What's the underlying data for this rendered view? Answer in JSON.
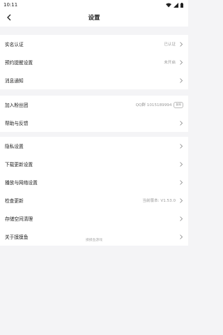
{
  "status_bar": {
    "time": "10:11"
  },
  "header": {
    "title": "设置"
  },
  "group1": [
    {
      "label": "实名认证",
      "value": "已认证"
    },
    {
      "label": "预约提醒设置",
      "value": "未开启"
    },
    {
      "label": "消息通知",
      "value": ""
    }
  ],
  "group2": [
    {
      "label": "加入粉丝团",
      "value": "QQ群 1015189994",
      "badge": "复制"
    },
    {
      "label": "帮助与反馈",
      "value": ""
    }
  ],
  "group3": [
    {
      "label": "隐私设置",
      "value": ""
    },
    {
      "label": "下载更新设置",
      "value": ""
    },
    {
      "label": "播放与网络设置",
      "value": ""
    },
    {
      "label": "检查更新",
      "value": "当前版本: V1.53.0"
    },
    {
      "label": "存储空间清理",
      "value": ""
    },
    {
      "label": "关于摸摸鱼",
      "value": ""
    }
  ],
  "footer": {
    "text": "摸摸鱼游戏"
  },
  "colors": {
    "background": "#f4f4f6",
    "card": "#ffffff",
    "muted_text": "#999999"
  }
}
